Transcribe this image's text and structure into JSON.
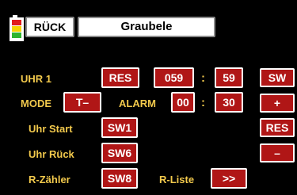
{
  "header": {
    "back_label": "RÜCK",
    "title": "Graubele"
  },
  "rows": {
    "uhr1_label": "UHR 1",
    "uhr1_res": "RES",
    "uhr1_minutes": "059",
    "uhr1_sep": ":",
    "uhr1_seconds": "59",
    "mode_label": "MODE",
    "mode_value": "T–",
    "alarm_label": "ALARM",
    "alarm_minutes": "00",
    "alarm_sep": ":",
    "alarm_seconds": "30",
    "uhr_start_label": "Uhr Start",
    "uhr_start_value": "SW1",
    "uhr_rueck_label": "Uhr Rück",
    "uhr_rueck_value": "SW6",
    "r_zaehler_label": "R-Zähler",
    "r_zaehler_value": "SW8",
    "r_liste_label": "R-Liste",
    "r_liste_value": ">>"
  },
  "side_buttons": {
    "sw": "SW",
    "plus": "+",
    "res": "RES",
    "minus": "–"
  },
  "colors": {
    "background": "#000000",
    "label": "#f2c94c",
    "value_button": "#b01616",
    "nav_button": "#ffffff",
    "battery": [
      "#e11c1c",
      "#f5d400",
      "#2fb52f"
    ]
  }
}
